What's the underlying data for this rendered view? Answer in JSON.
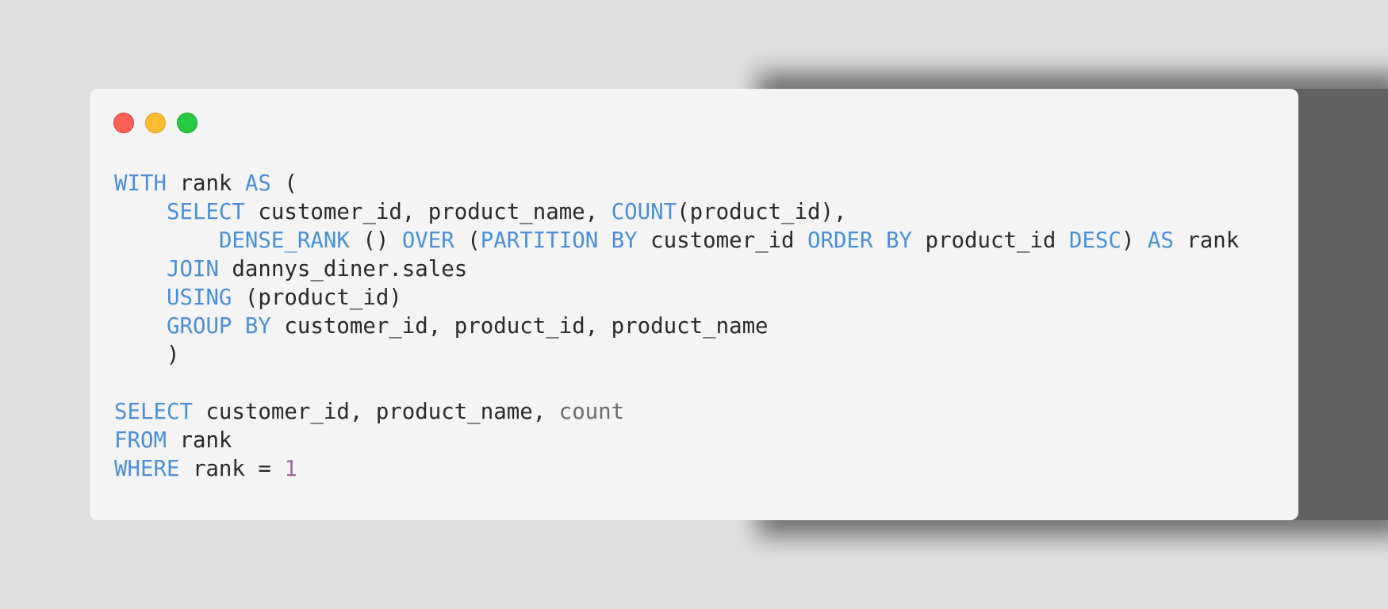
{
  "window": {
    "controls": [
      {
        "name": "close",
        "color": "#fe5f57"
      },
      {
        "name": "minimize",
        "color": "#febc2e"
      },
      {
        "name": "zoom",
        "color": "#28c840"
      }
    ]
  },
  "colors": {
    "keyword": "#4a90d9",
    "text": "#2a2a2a",
    "dim": "#6b6b6b",
    "number": "#a16e9c",
    "background": "#f4f4f4"
  },
  "code": {
    "language": "sql",
    "lines": [
      [
        {
          "t": "keyword",
          "v": "WITH"
        },
        {
          "t": "text",
          "v": " rank "
        },
        {
          "t": "keyword",
          "v": "AS"
        },
        {
          "t": "text",
          "v": " ("
        }
      ],
      [
        {
          "t": "text",
          "v": "    "
        },
        {
          "t": "keyword",
          "v": "SELECT"
        },
        {
          "t": "text",
          "v": " customer_id, product_name, "
        },
        {
          "t": "keyword",
          "v": "COUNT"
        },
        {
          "t": "text",
          "v": "(product_id),"
        }
      ],
      [
        {
          "t": "text",
          "v": "        "
        },
        {
          "t": "keyword",
          "v": "DENSE_RANK"
        },
        {
          "t": "text",
          "v": " () "
        },
        {
          "t": "keyword",
          "v": "OVER"
        },
        {
          "t": "text",
          "v": " ("
        },
        {
          "t": "keyword",
          "v": "PARTITION BY"
        },
        {
          "t": "text",
          "v": " customer_id "
        },
        {
          "t": "keyword",
          "v": "ORDER BY"
        },
        {
          "t": "text",
          "v": " product_id "
        },
        {
          "t": "keyword",
          "v": "DESC"
        },
        {
          "t": "text",
          "v": ") "
        },
        {
          "t": "keyword",
          "v": "AS"
        },
        {
          "t": "text",
          "v": " rank"
        }
      ],
      [
        {
          "t": "text",
          "v": "    "
        },
        {
          "t": "keyword",
          "v": "JOIN"
        },
        {
          "t": "text",
          "v": " dannys_diner.sales"
        }
      ],
      [
        {
          "t": "text",
          "v": "    "
        },
        {
          "t": "keyword",
          "v": "USING"
        },
        {
          "t": "text",
          "v": " (product_id)"
        }
      ],
      [
        {
          "t": "text",
          "v": "    "
        },
        {
          "t": "keyword",
          "v": "GROUP BY"
        },
        {
          "t": "text",
          "v": " customer_id, product_id, product_name"
        }
      ],
      [
        {
          "t": "text",
          "v": "    )"
        }
      ],
      [],
      [
        {
          "t": "keyword",
          "v": "SELECT"
        },
        {
          "t": "text",
          "v": " customer_id, product_name, "
        },
        {
          "t": "dim",
          "v": "count"
        }
      ],
      [
        {
          "t": "keyword",
          "v": "FROM"
        },
        {
          "t": "text",
          "v": " rank"
        }
      ],
      [
        {
          "t": "keyword",
          "v": "WHERE"
        },
        {
          "t": "text",
          "v": " rank = "
        },
        {
          "t": "number",
          "v": "1"
        }
      ]
    ]
  }
}
